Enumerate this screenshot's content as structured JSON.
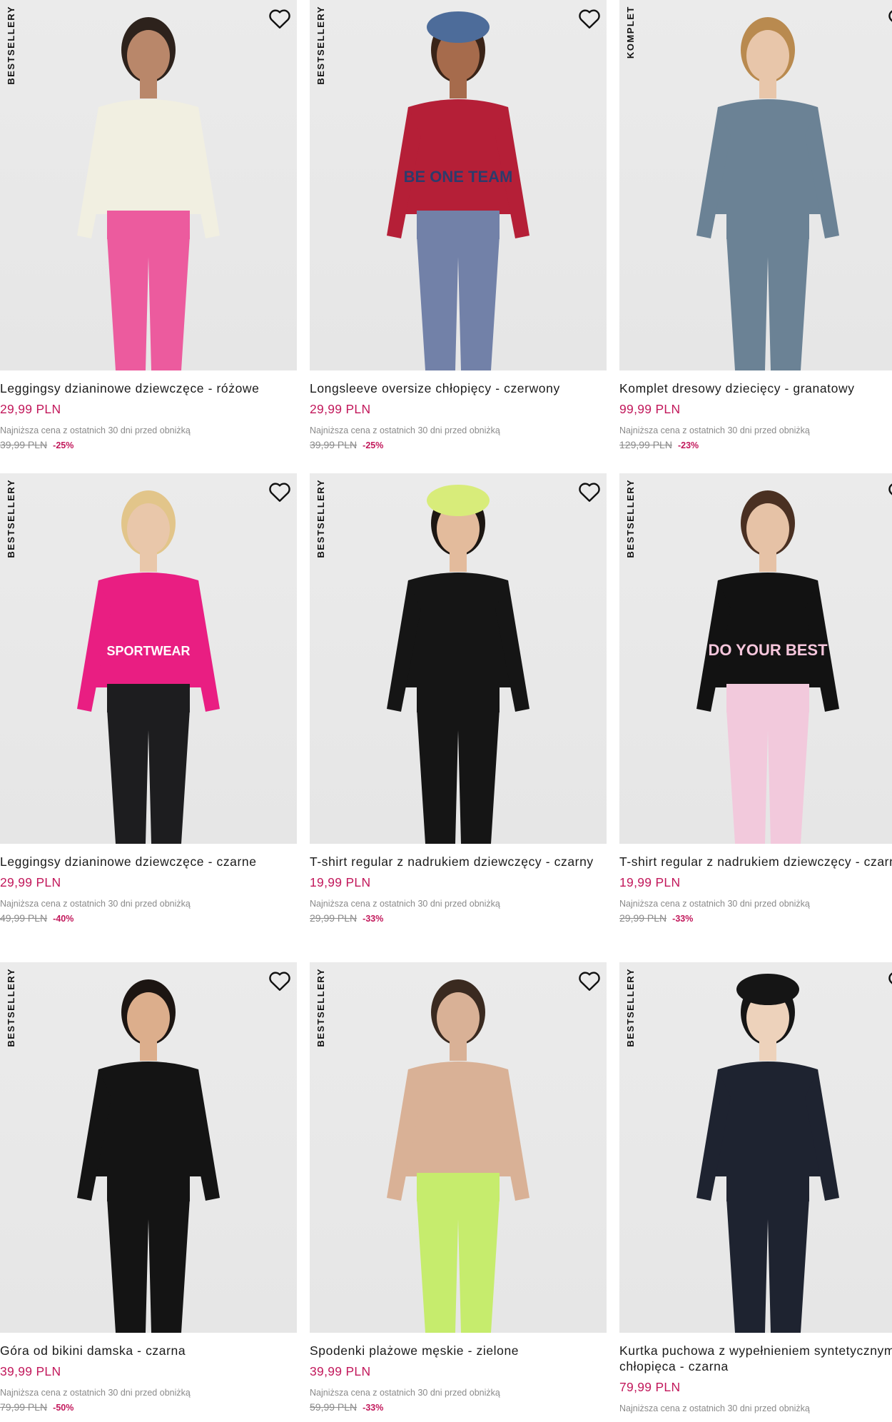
{
  "products": [
    {
      "badge": "BESTSELLERY",
      "name": "Leggingsy dzianinowe dziewczęce - różowe",
      "price": "29,99 PLN",
      "lowest_label": "Najniższa cena z ostatnich 30 dni przed obniżką",
      "old_price": "39,99 PLN",
      "discount": "-25%",
      "top_color": "#f1efe1",
      "bottom_color": "#ec5b9e",
      "skin": "#b9876a",
      "hair": "#2d221c"
    },
    {
      "badge": "BESTSELLERY",
      "name": "Longsleeve oversize chłopięcy - czerwony",
      "price": "29,99 PLN",
      "lowest_label": "Najniższa cena z ostatnich 30 dni przed obniżką",
      "old_price": "39,99 PLN",
      "discount": "-25%",
      "top_color": "#b51f37",
      "bottom_color": "#7281a8",
      "skin": "#a66b4c",
      "hair": "#3a2418",
      "print_text": "BE ONE TEAM",
      "cap": "#4d6c9a"
    },
    {
      "badge": "KOMPLET",
      "name": "Komplet dresowy dziecięcy - granatowy",
      "price": "99,99 PLN",
      "lowest_label": "Najniższa cena z ostatnich 30 dni przed obniżką",
      "old_price": "129,99 PLN",
      "discount": "-23%",
      "top_color": "#6b8295",
      "bottom_color": "#6b8295",
      "skin": "#e8c6aa",
      "hair": "#b98a4f"
    },
    {
      "badge": "BESTSELLERY",
      "name": "Leggingsy dzianinowe dziewczęce - czarne",
      "price": "29,99 PLN",
      "lowest_label": "Najniższa cena z ostatnich 30 dni przed obniżką",
      "old_price": "49,99 PLN",
      "discount": "-40%",
      "top_color": "#e91e82",
      "bottom_color": "#1d1d1f",
      "skin": "#e9c7aa",
      "hair": "#e2c58a",
      "print_text": "SPORTWEAR"
    },
    {
      "badge": "BESTSELLERY",
      "name": "T-shirt regular z nadrukiem dziewczęcy - czarny",
      "price": "19,99 PLN",
      "lowest_label": "Najniższa cena z ostatnich 30 dni przed obniżką",
      "old_price": "29,99 PLN",
      "discount": "-33%",
      "top_color": "#151515",
      "bottom_color": "#151515",
      "skin": "#e3bb9c",
      "hair": "#1c1612",
      "cap": "#d8ec7a"
    },
    {
      "badge": "BESTSELLERY",
      "name": "T-shirt regular z nadrukiem dziewczęcy - czarny",
      "price": "19,99 PLN",
      "lowest_label": "Najniższa cena z ostatnich 30 dni przed obniżką",
      "old_price": "29,99 PLN",
      "discount": "-33%",
      "top_color": "#121212",
      "bottom_color": "#f2c9dc",
      "skin": "#e6c2a6",
      "hair": "#4a3022",
      "print_text": "DO YOUR BEST"
    },
    {
      "badge": "BESTSELLERY",
      "name": "Góra od bikini damska - czarna",
      "price": "39,99 PLN",
      "lowest_label": "Najniższa cena z ostatnich 30 dni przed obniżką",
      "old_price": "79,99 PLN",
      "discount": "-50%",
      "top_color": "#141414",
      "bottom_color": "#141414",
      "skin": "#dcae8c",
      "hair": "#1c1512"
    },
    {
      "badge": "BESTSELLERY",
      "name": "Spodenki plażowe męskie - zielone",
      "price": "39,99 PLN",
      "lowest_label": "Najniższa cena z ostatnich 30 dni przed obniżką",
      "old_price": "59,99 PLN",
      "discount": "-33%",
      "top_color": "#d9b196",
      "bottom_color": "#c6ec6d",
      "skin": "#d9b196",
      "hair": "#3a2a20"
    },
    {
      "badge": "BESTSELLERY",
      "name": "Kurtka puchowa z wypełnieniem syntetycznym chłopięca - czarna",
      "price": "79,99 PLN",
      "lowest_label": "Najniższa cena z ostatnich 30 dni przed obniżką",
      "old_price": "",
      "discount": "",
      "top_color": "#1e2330",
      "bottom_color": "#1e2330",
      "skin": "#edd2bb",
      "hair": "#151515",
      "cap": "#151515"
    }
  ],
  "colors": {
    "accent_price": "#c2185b",
    "muted": "#8a8a8a",
    "image_bg": "#e9e9e9"
  },
  "icons": {
    "wishlist": "heart-outline-icon"
  }
}
